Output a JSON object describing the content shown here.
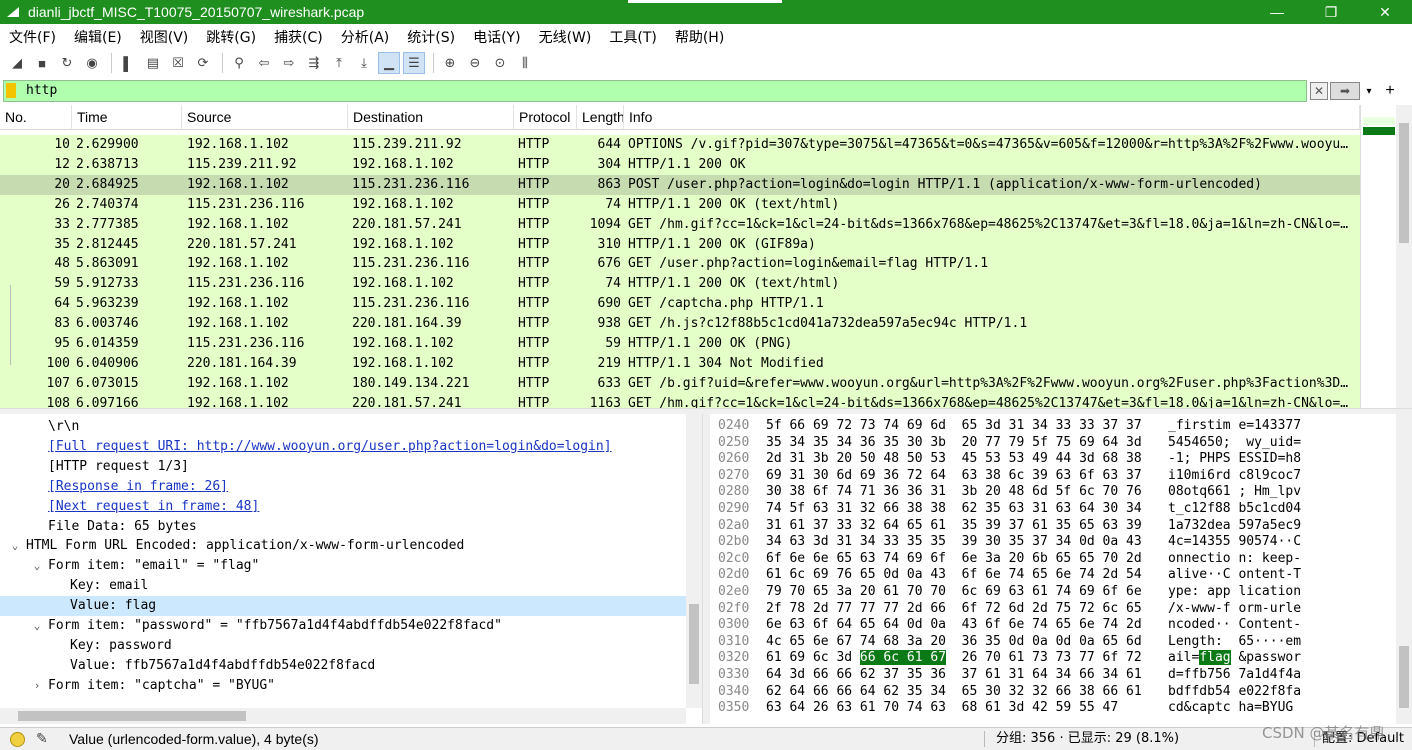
{
  "window": {
    "title": "dianli_jbctf_MISC_T10075_20150707_wireshark.pcap",
    "minimize_glyph": "—",
    "maximize_glyph": "❐",
    "close_glyph": "✕"
  },
  "menu": [
    {
      "label": "文件(F)"
    },
    {
      "label": "编辑(E)"
    },
    {
      "label": "视图(V)"
    },
    {
      "label": "跳转(G)"
    },
    {
      "label": "捕获(C)"
    },
    {
      "label": "分析(A)"
    },
    {
      "label": "统计(S)"
    },
    {
      "label": "电话(Y)"
    },
    {
      "label": "无线(W)"
    },
    {
      "label": "工具(T)"
    },
    {
      "label": "帮助(H)"
    }
  ],
  "toolbar": [
    {
      "icon": "shark-fin-start-icon",
      "glyph": "◢"
    },
    {
      "icon": "stop-capture-icon",
      "glyph": "■"
    },
    {
      "icon": "restart-capture-icon",
      "glyph": "↻"
    },
    {
      "icon": "capture-options-icon",
      "glyph": "◉"
    },
    {
      "icon": "open-file-icon",
      "glyph": "▌"
    },
    {
      "icon": "save-file-icon",
      "glyph": "▤"
    },
    {
      "icon": "close-file-icon",
      "glyph": "☒"
    },
    {
      "icon": "reload-file-icon",
      "glyph": "⟳"
    },
    {
      "icon": "find-packet-icon",
      "glyph": "⚲"
    },
    {
      "icon": "go-back-icon",
      "glyph": "⇦"
    },
    {
      "icon": "go-forward-icon",
      "glyph": "⇨"
    },
    {
      "icon": "go-to-packet-icon",
      "glyph": "⇶"
    },
    {
      "icon": "go-first-icon",
      "glyph": "⤒"
    },
    {
      "icon": "go-last-icon",
      "glyph": "⤓"
    },
    {
      "icon": "auto-scroll-icon",
      "glyph": "▁",
      "active": true
    },
    {
      "icon": "colorize-icon",
      "glyph": "☰",
      "active": true
    },
    {
      "icon": "zoom-in-icon",
      "glyph": "⊕"
    },
    {
      "icon": "zoom-out-icon",
      "glyph": "⊖"
    },
    {
      "icon": "zoom-reset-icon",
      "glyph": "⊙"
    },
    {
      "icon": "resize-columns-icon",
      "glyph": "⫼"
    }
  ],
  "filter": {
    "value": "http",
    "clear_glyph": "✕",
    "apply_glyph": "➡",
    "dropdown_glyph": "▾",
    "add_glyph": "+"
  },
  "packet_list": {
    "columns": [
      "No.",
      "Time",
      "Source",
      "Destination",
      "Protocol",
      "Length",
      "Info"
    ],
    "rows": [
      {
        "no": "10",
        "time": "2.629900",
        "src": "192.168.1.102",
        "dst": "115.239.211.92",
        "proto": "HTTP",
        "len": "644",
        "info": "OPTIONS /v.gif?pid=307&type=3075&l=47365&t=0&s=47365&v=605&f=12000&r=http%3A%2F%2Fwww.wooyu…"
      },
      {
        "no": "12",
        "time": "2.638713",
        "src": "115.239.211.92",
        "dst": "192.168.1.102",
        "proto": "HTTP",
        "len": "304",
        "info": "HTTP/1.1 200 OK"
      },
      {
        "no": "20",
        "time": "2.684925",
        "src": "192.168.1.102",
        "dst": "115.231.236.116",
        "proto": "HTTP",
        "len": "863",
        "info": "POST /user.php?action=login&do=login HTTP/1.1  (application/x-www-form-urlencoded)",
        "selected": true
      },
      {
        "no": "26",
        "time": "2.740374",
        "src": "115.231.236.116",
        "dst": "192.168.1.102",
        "proto": "HTTP",
        "len": "74",
        "info": "HTTP/1.1 200 OK  (text/html)"
      },
      {
        "no": "33",
        "time": "2.777385",
        "src": "192.168.1.102",
        "dst": "220.181.57.241",
        "proto": "HTTP",
        "len": "1094",
        "info": "GET /hm.gif?cc=1&ck=1&cl=24-bit&ds=1366x768&ep=48625%2C13747&et=3&fl=18.0&ja=1&ln=zh-CN&lo=…"
      },
      {
        "no": "35",
        "time": "2.812445",
        "src": "220.181.57.241",
        "dst": "192.168.1.102",
        "proto": "HTTP",
        "len": "310",
        "info": "HTTP/1.1 200 OK  (GIF89a)"
      },
      {
        "no": "48",
        "time": "5.863091",
        "src": "192.168.1.102",
        "dst": "115.231.236.116",
        "proto": "HTTP",
        "len": "676",
        "info": "GET /user.php?action=login&email=flag HTTP/1.1"
      },
      {
        "no": "59",
        "time": "5.912733",
        "src": "115.231.236.116",
        "dst": "192.168.1.102",
        "proto": "HTTP",
        "len": "74",
        "info": "HTTP/1.1 200 OK  (text/html)"
      },
      {
        "no": "64",
        "time": "5.963239",
        "src": "192.168.1.102",
        "dst": "115.231.236.116",
        "proto": "HTTP",
        "len": "690",
        "info": "GET /captcha.php HTTP/1.1"
      },
      {
        "no": "83",
        "time": "6.003746",
        "src": "192.168.1.102",
        "dst": "220.181.164.39",
        "proto": "HTTP",
        "len": "938",
        "info": "GET /h.js?c12f88b5c1cd041a732dea597a5ec94c HTTP/1.1"
      },
      {
        "no": "95",
        "time": "6.014359",
        "src": "115.231.236.116",
        "dst": "192.168.1.102",
        "proto": "HTTP",
        "len": "59",
        "info": "HTTP/1.1 200 OK  (PNG)"
      },
      {
        "no": "100",
        "time": "6.040906",
        "src": "220.181.164.39",
        "dst": "192.168.1.102",
        "proto": "HTTP",
        "len": "219",
        "info": "HTTP/1.1 304 Not Modified"
      },
      {
        "no": "107",
        "time": "6.073015",
        "src": "192.168.1.102",
        "dst": "180.149.134.221",
        "proto": "HTTP",
        "len": "633",
        "info": "GET /b.gif?uid=&refer=www.wooyun.org&url=http%3A%2F%2Fwww.wooyun.org%2Fuser.php%3Faction%3D…"
      },
      {
        "no": "108",
        "time": "6.097166",
        "src": "192.168.1.102",
        "dst": "220.181.57.241",
        "proto": "HTTP",
        "len": "1163",
        "info": "GET /hm.gif?cc=1&ck=1&cl=24-bit&ds=1366x768&ep=48625%2C13747&et=3&fl=18.0&ja=1&ln=zh-CN&lo=…"
      }
    ]
  },
  "details": {
    "rows": [
      {
        "indent": 2,
        "text": "\\r\\n"
      },
      {
        "indent": 2,
        "text": "[Full request URI: http://www.wooyun.org/user.php?action=login&do=login]",
        "link": true
      },
      {
        "indent": 2,
        "text": "[HTTP request 1/3]"
      },
      {
        "indent": 2,
        "text": "[Response in frame: 26]",
        "link": true
      },
      {
        "indent": 2,
        "text": "[Next request in frame: 48]",
        "link": true
      },
      {
        "indent": 2,
        "text": "File Data: 65 bytes"
      },
      {
        "indent": 1,
        "text": "HTML Form URL Encoded: application/x-www-form-urlencoded",
        "arrow": "⌄"
      },
      {
        "indent": 2,
        "text": "Form item: \"email\" = \"flag\"",
        "arrow": "⌄"
      },
      {
        "indent": 3,
        "text": "Key: email"
      },
      {
        "indent": 3,
        "text": "Value: flag",
        "selected": true
      },
      {
        "indent": 2,
        "text": "Form item: \"password\" = \"ffb7567a1d4f4abdffdb54e022f8facd\"",
        "arrow": "⌄"
      },
      {
        "indent": 3,
        "text": "Key: password"
      },
      {
        "indent": 3,
        "text": "Value: ffb7567a1d4f4abdffdb54e022f8facd"
      },
      {
        "indent": 2,
        "text": "Form item: \"captcha\" = \"BYUG\"",
        "arrow": "›"
      }
    ]
  },
  "bytes": {
    "rows": [
      {
        "off": "0240",
        "hex1": "5f 66 69 72 73 74 69 6d",
        "hex2": "65 3d 31 34 33 33 37 37",
        "asc1": "_firstim",
        "asc2": "e=143377"
      },
      {
        "off": "0250",
        "hex1": "35 34 35 34 36 35 30 3b",
        "hex2": "20 77 79 5f 75 69 64 3d",
        "asc1": "5454650;",
        "asc2": " wy_uid="
      },
      {
        "off": "0260",
        "hex1": "2d 31 3b 20 50 48 50 53",
        "hex2": "45 53 53 49 44 3d 68 38",
        "asc1": "-1; PHPS",
        "asc2": "ESSID=h8"
      },
      {
        "off": "0270",
        "hex1": "69 31 30 6d 69 36 72 64",
        "hex2": "63 38 6c 39 63 6f 63 37",
        "asc1": "i10mi6rd",
        "asc2": "c8l9coc7"
      },
      {
        "off": "0280",
        "hex1": "30 38 6f 74 71 36 36 31",
        "hex2": "3b 20 48 6d 5f 6c 70 76",
        "asc1": "08otq661",
        "asc2": "; Hm_lpv"
      },
      {
        "off": "0290",
        "hex1": "74 5f 63 31 32 66 38 38",
        "hex2": "62 35 63 31 63 64 30 34",
        "asc1": "t_c12f88",
        "asc2": "b5c1cd04"
      },
      {
        "off": "02a0",
        "hex1": "31 61 37 33 32 64 65 61",
        "hex2": "35 39 37 61 35 65 63 39",
        "asc1": "1a732dea",
        "asc2": "597a5ec9"
      },
      {
        "off": "02b0",
        "hex1": "34 63 3d 31 34 33 35 35",
        "hex2": "39 30 35 37 34 0d 0a 43",
        "asc1": "4c=14355",
        "asc2": "90574··C"
      },
      {
        "off": "02c0",
        "hex1": "6f 6e 6e 65 63 74 69 6f",
        "hex2": "6e 3a 20 6b 65 65 70 2d",
        "asc1": "onnectio",
        "asc2": "n: keep-"
      },
      {
        "off": "02d0",
        "hex1": "61 6c 69 76 65 0d 0a 43",
        "hex2": "6f 6e 74 65 6e 74 2d 54",
        "asc1": "alive··C",
        "asc2": "ontent-T"
      },
      {
        "off": "02e0",
        "hex1": "79 70 65 3a 20 61 70 70",
        "hex2": "6c 69 63 61 74 69 6f 6e",
        "asc1": "ype: app",
        "asc2": "lication"
      },
      {
        "off": "02f0",
        "hex1": "2f 78 2d 77 77 77 2d 66",
        "hex2": "6f 72 6d 2d 75 72 6c 65",
        "asc1": "/x-www-f",
        "asc2": "orm-urle"
      },
      {
        "off": "0300",
        "hex1": "6e 63 6f 64 65 64 0d 0a",
        "hex2": "43 6f 6e 74 65 6e 74 2d",
        "asc1": "ncoded··",
        "asc2": "Content-"
      },
      {
        "off": "0310",
        "hex1": "4c 65 6e 67 74 68 3a 20",
        "hex2": "36 35 0d 0a 0d 0a 65 6d",
        "asc1": "Length: ",
        "asc2": "65····em"
      },
      {
        "off": "0320",
        "hex1": "61 69 6c 3d",
        "hex1_hl": "66 6c 61 67",
        "hex2": "26 70 61 73 73 77 6f 72",
        "asc1": "ail=",
        "asc1_hl": "flag",
        "asc2": "&passwor"
      },
      {
        "off": "0330",
        "hex1": "64 3d 66 66 62 37 35 36",
        "hex2": "37 61 31 64 34 66 34 61",
        "asc1": "d=ffb756",
        "asc2": "7a1d4f4a"
      },
      {
        "off": "0340",
        "hex1": "62 64 66 66 64 62 35 34",
        "hex2": "65 30 32 32 66 38 66 61",
        "asc1": "bdffdb54",
        "asc2": "e022f8fa"
      },
      {
        "off": "0350",
        "hex1": "63 64 26 63 61 70 74 63",
        "hex2": "68 61 3d 42 59 55 47",
        "asc1": "cd&captc",
        "asc2": "ha=BYUG"
      }
    ]
  },
  "status": {
    "field": "Value (urlencoded-form.value), 4 byte(s)",
    "counts": "分组: 356 · 已显示: 29 (8.1%)",
    "profile": "配置: Default",
    "watermark": "CSDN @某名有鼎"
  },
  "colors": {
    "titlebar": "#1f8f1f",
    "filter_ok": "#afffaf",
    "http_row": "#e4ffc7",
    "selected_row": "#c6dcb0",
    "byte_highlight": "#0b7a16",
    "link": "#1a34c4"
  }
}
